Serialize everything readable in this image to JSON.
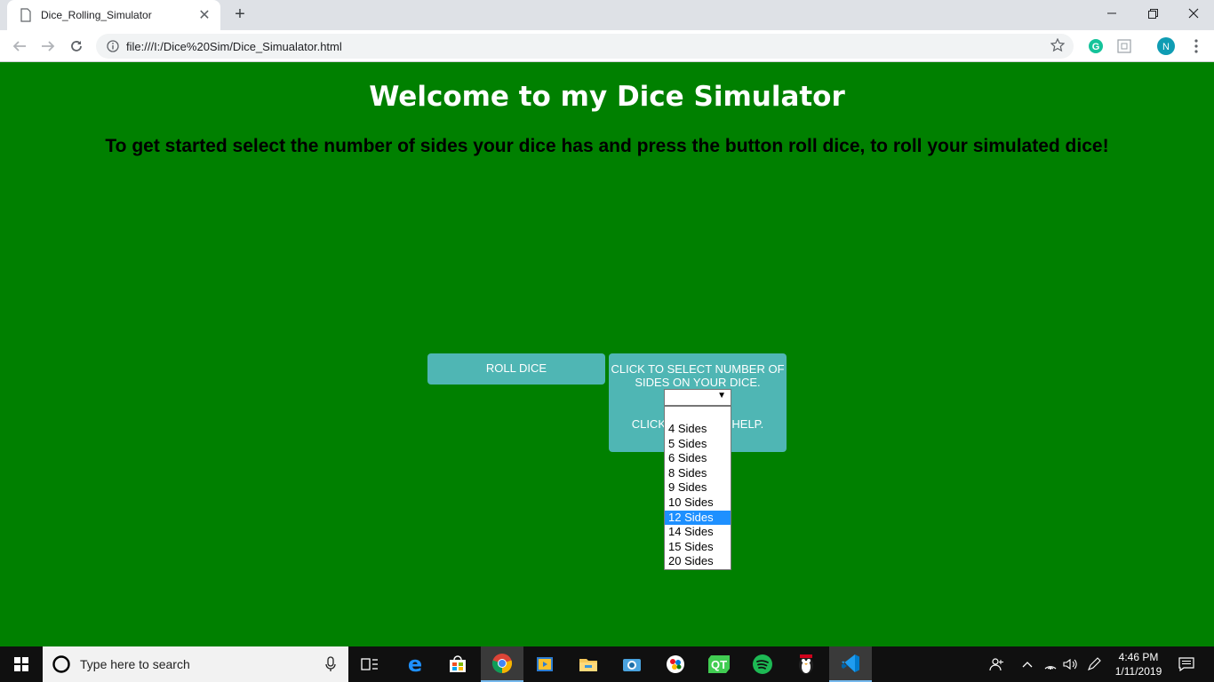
{
  "browser": {
    "tab_title": "Dice_Rolling_Simulator",
    "url": "file:///I:/Dice%20Sim/Dice_Simualator.html",
    "profile_initial": "N"
  },
  "page": {
    "heading": "Welcome to my Dice Simulator",
    "subheading": "To get started select the number of sides your dice has and press the button roll dice, to roll your simulated dice!",
    "roll_button": "ROLL DICE",
    "select_label": "CLICK TO SELECT NUMBER OF SIDES ON YOUR DICE.",
    "help_text": "CLICK HERE FOR HELP.",
    "dropdown_options": [
      "4 Sides",
      "5 Sides",
      "6 Sides",
      "8 Sides",
      "9 Sides",
      "10 Sides",
      "12 Sides",
      "14 Sides",
      "15 Sides",
      "20 Sides"
    ],
    "highlighted_option": "12 Sides"
  },
  "taskbar": {
    "search_placeholder": "Type here to search",
    "time": "4:46 PM",
    "date": "1/11/2019"
  },
  "colors": {
    "page_bg": "#008000",
    "button_bg": "#4fb6b4",
    "highlight": "#1e90ff"
  }
}
